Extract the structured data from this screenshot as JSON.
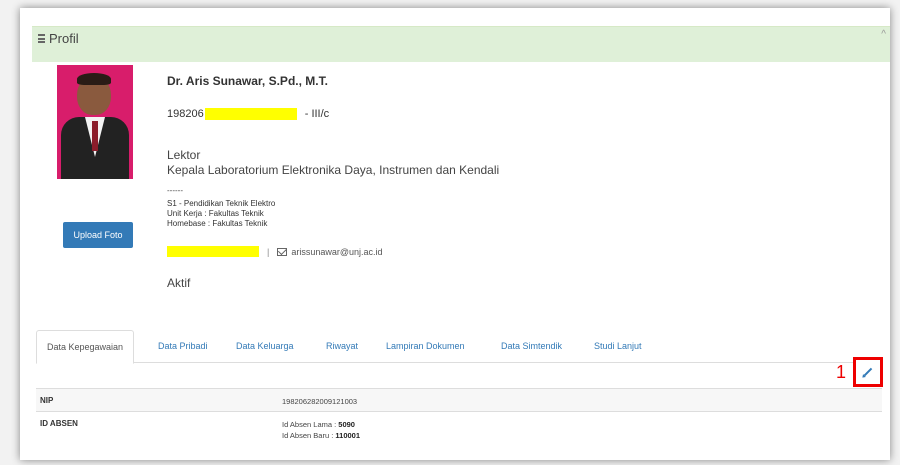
{
  "header": {
    "title": "Profil"
  },
  "profile": {
    "upload_label": "Upload Foto",
    "name": "Dr. Aris Sunawar, S.Pd., M.T.",
    "nip_prefix": "198206",
    "grade": "- III/c",
    "rank": "Lektor",
    "position": "Kepala Laboratorium Elektronika Daya, Instrumen dan Kendali",
    "dashes": "------",
    "education": "S1 - Pendidikan Teknik Elektro",
    "work_unit": "Unit Kerja : Fakultas Teknik",
    "homebase": "Homebase : Fakultas Teknik",
    "separator": "|",
    "email": "arissunawar@unj.ac.id",
    "status": "Aktif"
  },
  "tabs": [
    {
      "label": "Data Kepegawaian"
    },
    {
      "label": "Data Pribadi"
    },
    {
      "label": "Data Keluarga"
    },
    {
      "label": "Riwayat"
    },
    {
      "label": "Lampiran Dokumen"
    },
    {
      "label": "Data Simtendik"
    },
    {
      "label": "Studi Lanjut"
    }
  ],
  "annotation": {
    "number": "1"
  },
  "table": {
    "nip_label": "NIP",
    "nip_value": "198206282009121003",
    "absen_label": "ID ABSEN",
    "absen_old_label": "Id Absen Lama :",
    "absen_old_value": "5090",
    "absen_new_label": "Id Absen Baru :",
    "absen_new_value": "110001"
  },
  "colors": {
    "header_bg": "#dff0d8",
    "link": "#337ab7",
    "highlight": "#ffff00",
    "annotation": "#ee0000"
  }
}
